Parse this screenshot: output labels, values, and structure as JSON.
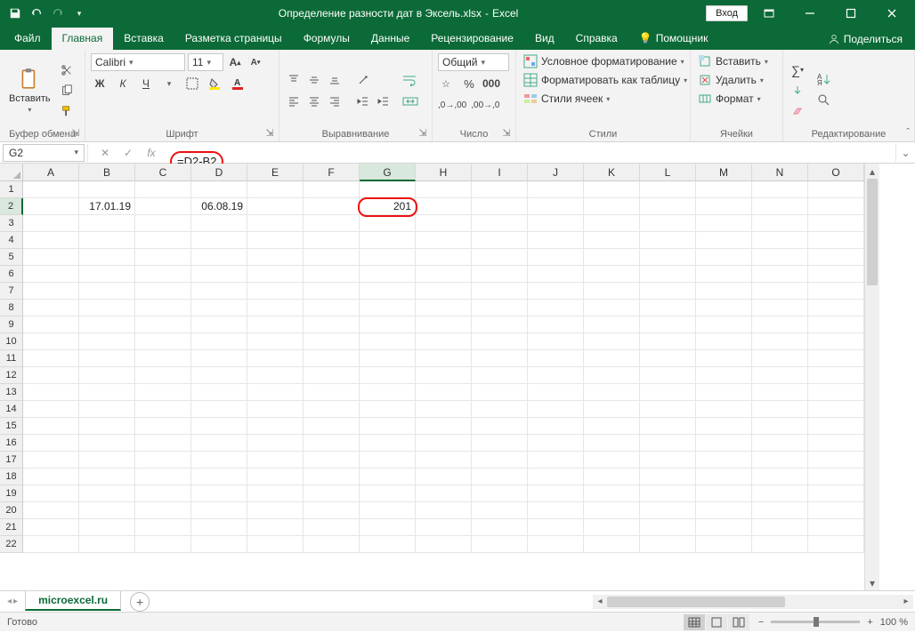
{
  "title": {
    "doc": "Определение разности дат в Эксель.xlsx",
    "sep": "-",
    "app": "Excel"
  },
  "login": "Вход",
  "tabs": [
    "Файл",
    "Главная",
    "Вставка",
    "Разметка страницы",
    "Формулы",
    "Данные",
    "Рецензирование",
    "Вид",
    "Справка"
  ],
  "active_tab": 1,
  "assistant": "Помощник",
  "share": "Поделиться",
  "ribbon": {
    "clipboard": {
      "paste": "Вставить",
      "label": "Буфер обмена"
    },
    "font": {
      "name": "Calibri",
      "size": "11",
      "label": "Шрифт",
      "bold": "Ж",
      "italic": "К",
      "underline": "Ч"
    },
    "alignment": {
      "label": "Выравнивание"
    },
    "number": {
      "format": "Общий",
      "label": "Число"
    },
    "styles": {
      "cond": "Условное форматирование",
      "table": "Форматировать как таблицу",
      "cell": "Стили ячеек",
      "label": "Стили"
    },
    "cells": {
      "insert": "Вставить",
      "delete": "Удалить",
      "format": "Формат",
      "label": "Ячейки"
    },
    "editing": {
      "label": "Редактирование"
    }
  },
  "namebox": "G2",
  "formula": "=D2-B2",
  "columns": [
    "A",
    "B",
    "C",
    "D",
    "E",
    "F",
    "G",
    "H",
    "I",
    "J",
    "K",
    "L",
    "M",
    "N",
    "O"
  ],
  "rows": [
    1,
    2,
    3,
    4,
    5,
    6,
    7,
    8,
    9,
    10,
    11,
    12,
    13,
    14,
    15,
    16,
    17,
    18,
    19,
    20,
    21,
    22
  ],
  "selected_col": 6,
  "selected_row": 1,
  "data": {
    "B2": "17.01.19",
    "D2": "06.08.19",
    "G2": "201"
  },
  "sheet": "microexcel.ru",
  "status": "Готово",
  "zoom": "100 %"
}
